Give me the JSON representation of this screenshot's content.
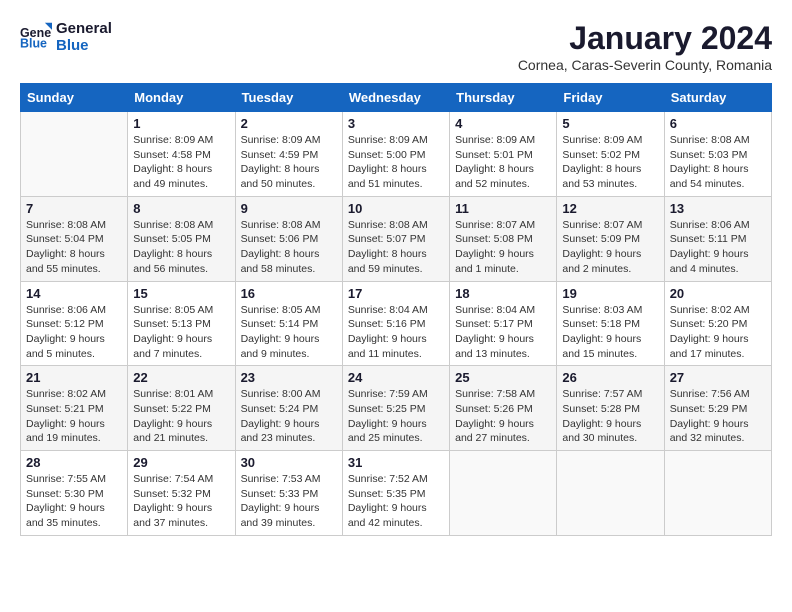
{
  "logo": {
    "line1": "General",
    "line2": "Blue"
  },
  "title": "January 2024",
  "subtitle": "Cornea, Caras-Severin County, Romania",
  "headers": [
    "Sunday",
    "Monday",
    "Tuesday",
    "Wednesday",
    "Thursday",
    "Friday",
    "Saturday"
  ],
  "weeks": [
    [
      {
        "date": "",
        "info": ""
      },
      {
        "date": "1",
        "info": "Sunrise: 8:09 AM\nSunset: 4:58 PM\nDaylight: 8 hours\nand 49 minutes."
      },
      {
        "date": "2",
        "info": "Sunrise: 8:09 AM\nSunset: 4:59 PM\nDaylight: 8 hours\nand 50 minutes."
      },
      {
        "date": "3",
        "info": "Sunrise: 8:09 AM\nSunset: 5:00 PM\nDaylight: 8 hours\nand 51 minutes."
      },
      {
        "date": "4",
        "info": "Sunrise: 8:09 AM\nSunset: 5:01 PM\nDaylight: 8 hours\nand 52 minutes."
      },
      {
        "date": "5",
        "info": "Sunrise: 8:09 AM\nSunset: 5:02 PM\nDaylight: 8 hours\nand 53 minutes."
      },
      {
        "date": "6",
        "info": "Sunrise: 8:08 AM\nSunset: 5:03 PM\nDaylight: 8 hours\nand 54 minutes."
      }
    ],
    [
      {
        "date": "7",
        "info": "Sunrise: 8:08 AM\nSunset: 5:04 PM\nDaylight: 8 hours\nand 55 minutes."
      },
      {
        "date": "8",
        "info": "Sunrise: 8:08 AM\nSunset: 5:05 PM\nDaylight: 8 hours\nand 56 minutes."
      },
      {
        "date": "9",
        "info": "Sunrise: 8:08 AM\nSunset: 5:06 PM\nDaylight: 8 hours\nand 58 minutes."
      },
      {
        "date": "10",
        "info": "Sunrise: 8:08 AM\nSunset: 5:07 PM\nDaylight: 8 hours\nand 59 minutes."
      },
      {
        "date": "11",
        "info": "Sunrise: 8:07 AM\nSunset: 5:08 PM\nDaylight: 9 hours\nand 1 minute."
      },
      {
        "date": "12",
        "info": "Sunrise: 8:07 AM\nSunset: 5:09 PM\nDaylight: 9 hours\nand 2 minutes."
      },
      {
        "date": "13",
        "info": "Sunrise: 8:06 AM\nSunset: 5:11 PM\nDaylight: 9 hours\nand 4 minutes."
      }
    ],
    [
      {
        "date": "14",
        "info": "Sunrise: 8:06 AM\nSunset: 5:12 PM\nDaylight: 9 hours\nand 5 minutes."
      },
      {
        "date": "15",
        "info": "Sunrise: 8:05 AM\nSunset: 5:13 PM\nDaylight: 9 hours\nand 7 minutes."
      },
      {
        "date": "16",
        "info": "Sunrise: 8:05 AM\nSunset: 5:14 PM\nDaylight: 9 hours\nand 9 minutes."
      },
      {
        "date": "17",
        "info": "Sunrise: 8:04 AM\nSunset: 5:16 PM\nDaylight: 9 hours\nand 11 minutes."
      },
      {
        "date": "18",
        "info": "Sunrise: 8:04 AM\nSunset: 5:17 PM\nDaylight: 9 hours\nand 13 minutes."
      },
      {
        "date": "19",
        "info": "Sunrise: 8:03 AM\nSunset: 5:18 PM\nDaylight: 9 hours\nand 15 minutes."
      },
      {
        "date": "20",
        "info": "Sunrise: 8:02 AM\nSunset: 5:20 PM\nDaylight: 9 hours\nand 17 minutes."
      }
    ],
    [
      {
        "date": "21",
        "info": "Sunrise: 8:02 AM\nSunset: 5:21 PM\nDaylight: 9 hours\nand 19 minutes."
      },
      {
        "date": "22",
        "info": "Sunrise: 8:01 AM\nSunset: 5:22 PM\nDaylight: 9 hours\nand 21 minutes."
      },
      {
        "date": "23",
        "info": "Sunrise: 8:00 AM\nSunset: 5:24 PM\nDaylight: 9 hours\nand 23 minutes."
      },
      {
        "date": "24",
        "info": "Sunrise: 7:59 AM\nSunset: 5:25 PM\nDaylight: 9 hours\nand 25 minutes."
      },
      {
        "date": "25",
        "info": "Sunrise: 7:58 AM\nSunset: 5:26 PM\nDaylight: 9 hours\nand 27 minutes."
      },
      {
        "date": "26",
        "info": "Sunrise: 7:57 AM\nSunset: 5:28 PM\nDaylight: 9 hours\nand 30 minutes."
      },
      {
        "date": "27",
        "info": "Sunrise: 7:56 AM\nSunset: 5:29 PM\nDaylight: 9 hours\nand 32 minutes."
      }
    ],
    [
      {
        "date": "28",
        "info": "Sunrise: 7:55 AM\nSunset: 5:30 PM\nDaylight: 9 hours\nand 35 minutes."
      },
      {
        "date": "29",
        "info": "Sunrise: 7:54 AM\nSunset: 5:32 PM\nDaylight: 9 hours\nand 37 minutes."
      },
      {
        "date": "30",
        "info": "Sunrise: 7:53 AM\nSunset: 5:33 PM\nDaylight: 9 hours\nand 39 minutes."
      },
      {
        "date": "31",
        "info": "Sunrise: 7:52 AM\nSunset: 5:35 PM\nDaylight: 9 hours\nand 42 minutes."
      },
      {
        "date": "",
        "info": ""
      },
      {
        "date": "",
        "info": ""
      },
      {
        "date": "",
        "info": ""
      }
    ]
  ]
}
